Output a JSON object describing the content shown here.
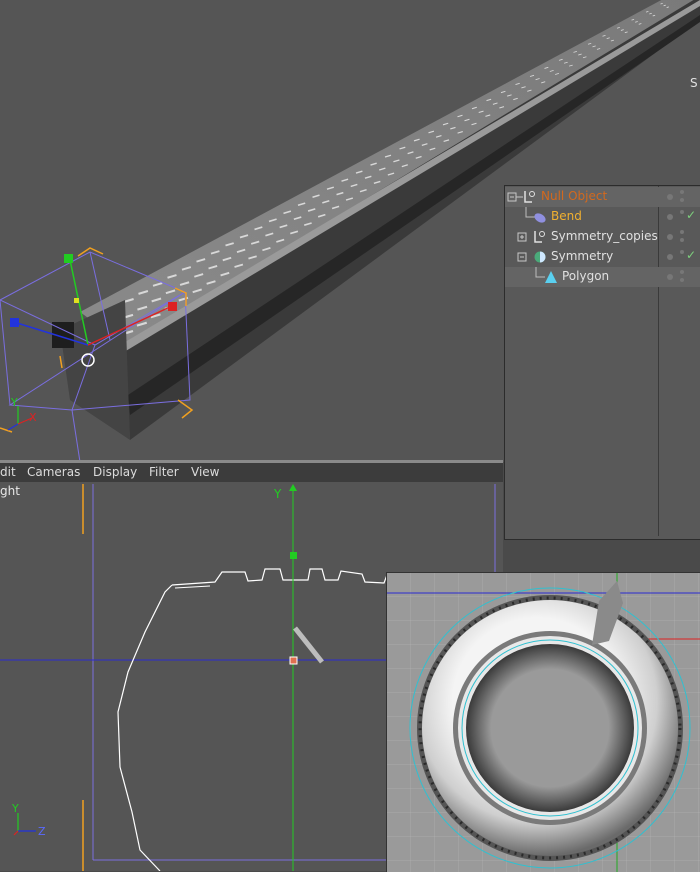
{
  "menu": {
    "items": [
      "dit",
      "Cameras",
      "Display",
      "Filter",
      "View"
    ]
  },
  "viewport_persp": {
    "corner_text": "S",
    "axis": {
      "y": "Y",
      "x": "X"
    }
  },
  "viewport_ortho": {
    "label": "ght",
    "axis_y": "Y",
    "axis": {
      "y": "Y",
      "z": "Z"
    }
  },
  "object_manager": {
    "items": [
      {
        "label": "Null Object",
        "icon": "null-object-icon",
        "color": "#d2691e"
      },
      {
        "label": "Bend",
        "icon": "bend-deformer-icon",
        "color": "#f0b030"
      },
      {
        "label": "Symmetry_copies",
        "icon": "null-object-icon",
        "color": "#e0e0e0"
      },
      {
        "label": "Symmetry",
        "icon": "symmetry-icon",
        "color": "#e0e0e0"
      },
      {
        "label": "Polygon",
        "icon": "polygon-icon",
        "color": "#e0e0e0"
      }
    ],
    "checks": [
      "✓",
      "✓"
    ]
  },
  "colors": {
    "selection_orange": "#f0a020",
    "bbox_purple": "#7a6ee0",
    "axis_green": "#22cc22",
    "axis_blue": "#2233dd",
    "axis_red": "#dd2222",
    "ortho_blue": "#2a2ad0",
    "cyan": "#30c0d0"
  }
}
